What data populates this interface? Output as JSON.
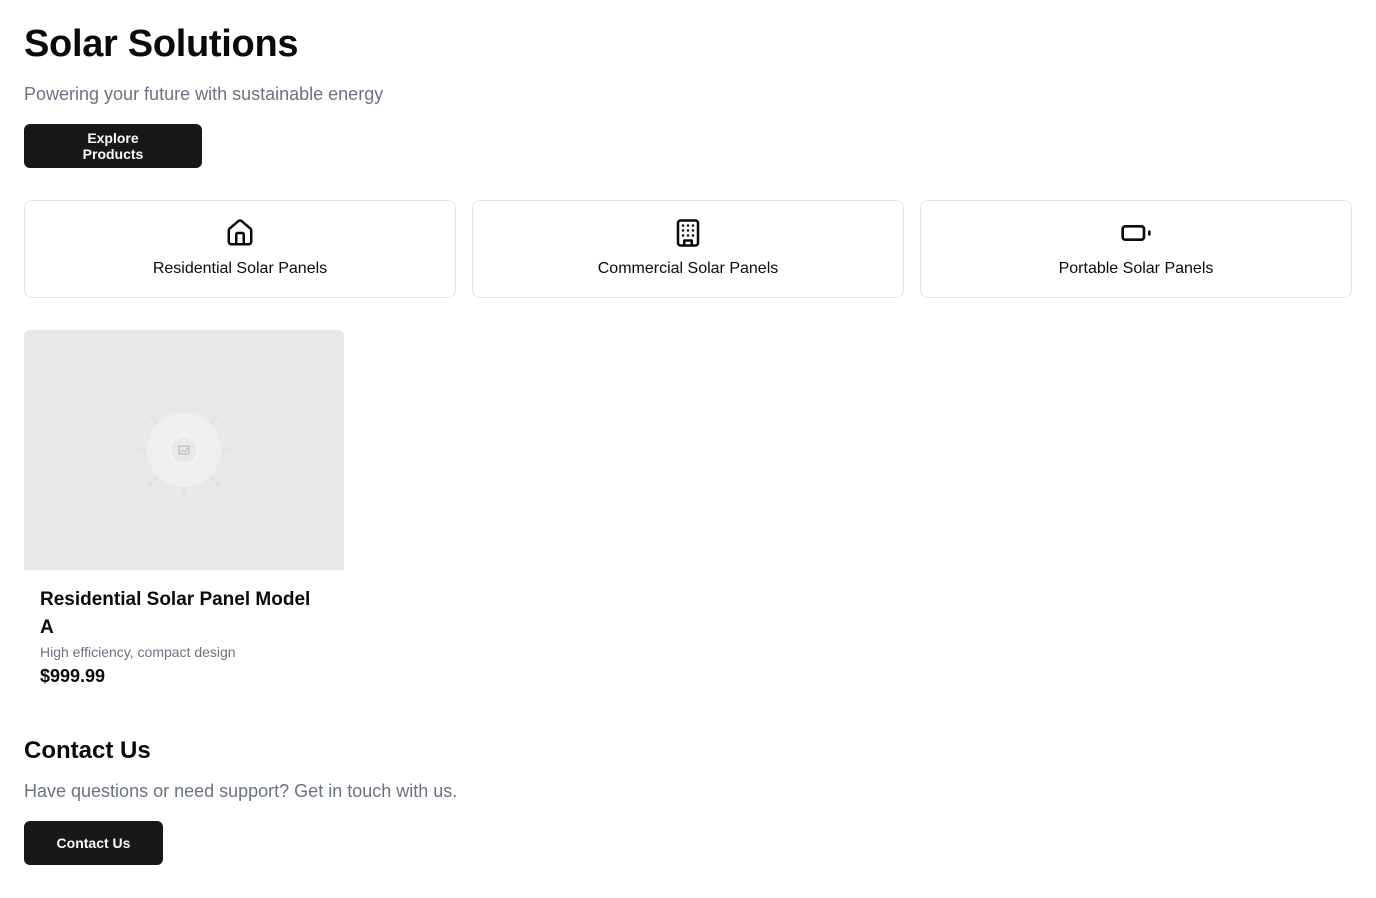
{
  "hero": {
    "title": "Solar Solutions",
    "subtitle": "Powering your future with sustainable energy",
    "cta_label": "Explore Products"
  },
  "categories": [
    {
      "label": "Residential Solar Panels",
      "icon": "house-icon"
    },
    {
      "label": "Commercial Solar Panels",
      "icon": "building-icon"
    },
    {
      "label": "Portable Solar Panels",
      "icon": "battery-icon"
    }
  ],
  "products": [
    {
      "name": "Residential Solar Panel Model A",
      "description": "High efficiency, compact design",
      "price": "$999.99",
      "image_icon": "image-placeholder-icon"
    }
  ],
  "contact": {
    "title": "Contact Us",
    "text": "Have questions or need support? Get in touch with us.",
    "button_label": "Contact Us"
  },
  "colors": {
    "primary_button": "#18181b",
    "muted_text": "#6b7280",
    "border": "#e4e4e7",
    "placeholder_bg": "#e8e8e8"
  }
}
